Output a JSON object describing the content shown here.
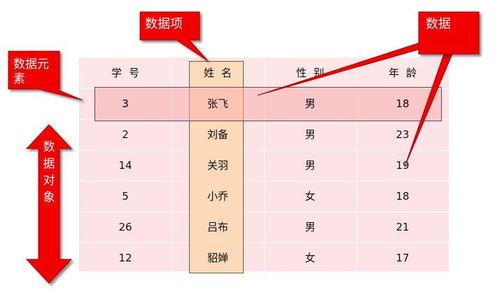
{
  "callouts": {
    "item": "数据项",
    "data": "数据",
    "element_line1": "数据元",
    "element_line2": "素",
    "object_chars": [
      "数",
      "据",
      "对",
      "象"
    ]
  },
  "table": {
    "headers": [
      "学号",
      "姓名",
      "性别",
      "年龄"
    ],
    "rows": [
      [
        "3",
        "张飞",
        "男",
        "18"
      ],
      [
        "2",
        "刘备",
        "男",
        "23"
      ],
      [
        "14",
        "关羽",
        "男",
        "19"
      ],
      [
        "5",
        "小乔",
        "女",
        "18"
      ],
      [
        "26",
        "吕布",
        "男",
        "21"
      ],
      [
        "12",
        "貂婵",
        "女",
        "17"
      ]
    ]
  },
  "colors": {
    "callout_red": "#f20000",
    "table_bg": "#fde3e5",
    "column_highlight": "#fcd8b2",
    "row_highlight": "#f8b0b0"
  }
}
